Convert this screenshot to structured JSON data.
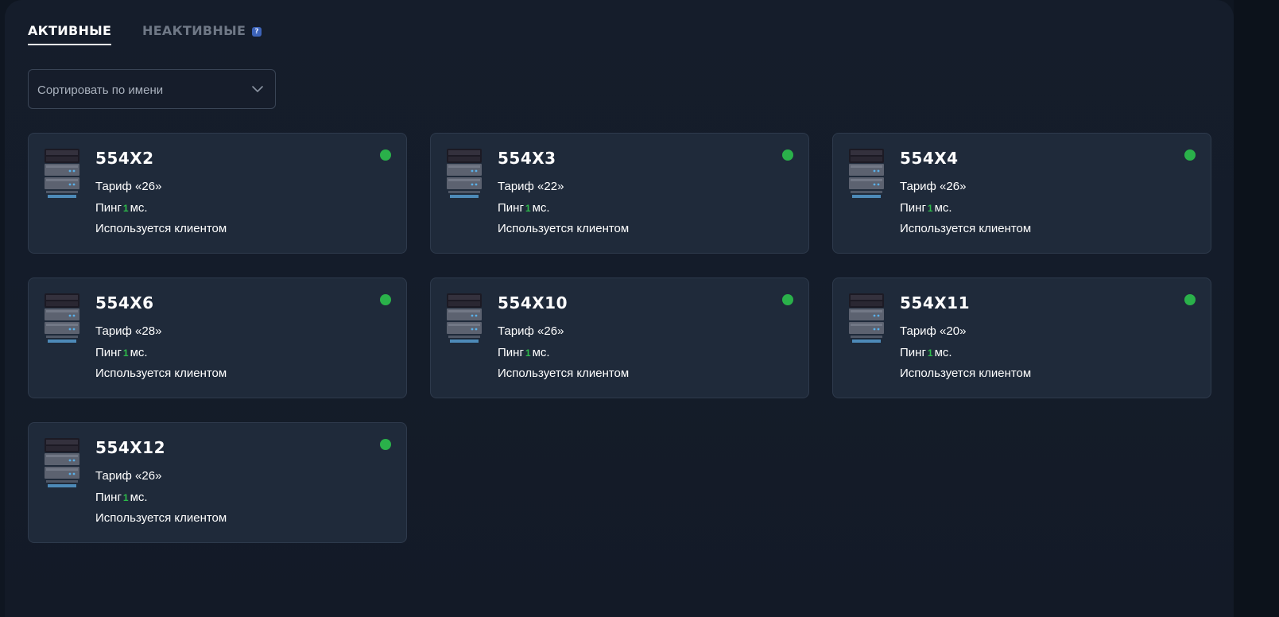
{
  "tabs": {
    "active": "АКТИВНЫЕ",
    "inactive": "НЕАКТИВНЫЕ",
    "help_glyph": "?"
  },
  "sort": {
    "selected": "Сортировать по имени"
  },
  "servers": [
    {
      "name": "554X2",
      "tariff": "Тариф «26»",
      "ping_label": "Пинг",
      "ping_value": "1",
      "ping_unit": "мс.",
      "usage": "Используется клиентом",
      "status": "online"
    },
    {
      "name": "554X3",
      "tariff": "Тариф «22»",
      "ping_label": "Пинг",
      "ping_value": "1",
      "ping_unit": "мс.",
      "usage": "Используется клиентом",
      "status": "online"
    },
    {
      "name": "554X4",
      "tariff": "Тариф «26»",
      "ping_label": "Пинг",
      "ping_value": "1",
      "ping_unit": "мс.",
      "usage": "Используется клиентом",
      "status": "online"
    },
    {
      "name": "554X6",
      "tariff": "Тариф «28»",
      "ping_label": "Пинг",
      "ping_value": "1",
      "ping_unit": "мс.",
      "usage": "Используется клиентом",
      "status": "online"
    },
    {
      "name": "554X10",
      "tariff": "Тариф «26»",
      "ping_label": "Пинг",
      "ping_value": "1",
      "ping_unit": "мс.",
      "usage": "Используется клиентом",
      "status": "online"
    },
    {
      "name": "554X11",
      "tariff": "Тариф «20»",
      "ping_label": "Пинг",
      "ping_value": "1",
      "ping_unit": "мс.",
      "usage": "Используется клиентом",
      "status": "online"
    },
    {
      "name": "554X12",
      "tariff": "Тариф «26»",
      "ping_label": "Пинг",
      "ping_value": "1",
      "ping_unit": "мс.",
      "usage": "Используется клиентом",
      "status": "online"
    }
  ],
  "icons": {
    "server": "server-icon",
    "status": "status-dot",
    "dropdown": "chevron-down-icon",
    "help": "help-icon"
  },
  "colors": {
    "background": "#141c29",
    "card": "#1f2a3a",
    "online": "#2ab14a",
    "ping": "#2dbb4a",
    "help_badge": "#3d63b8"
  }
}
